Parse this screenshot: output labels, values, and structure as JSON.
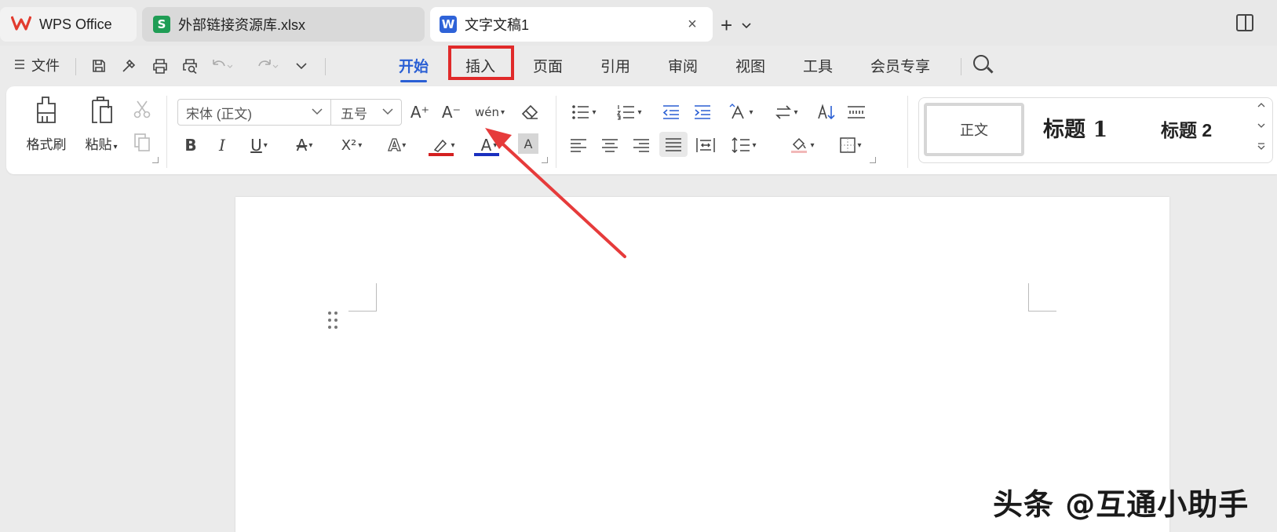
{
  "tabs": {
    "home": {
      "label": "WPS Office",
      "badge": "W",
      "color": "#e23b2e"
    },
    "xlsx": {
      "label": "外部链接资源库.xlsx",
      "badge": "S",
      "color": "#1f9d55"
    },
    "doc": {
      "label": "文字文稿1",
      "badge": "W",
      "color": "#2f63d8"
    },
    "close": "×",
    "new_tab": "+",
    "new_tab_menu": "⌄"
  },
  "menubar": {
    "file_label": "文件",
    "tabs": [
      "开始",
      "插入",
      "页面",
      "引用",
      "审阅",
      "视图",
      "工具",
      "会员专享"
    ],
    "active_tab": "开始",
    "highlighted_tab": "插入"
  },
  "ribbon": {
    "format_painter": "格式刷",
    "paste": "粘贴",
    "font_name": "宋体 (正文)",
    "font_size": "五号",
    "grow_font": "A⁺",
    "shrink_font": "A⁻",
    "pinyin": "wén",
    "bold": "B",
    "italic": "I",
    "underline": "U",
    "strike": "A",
    "superscript": "X²",
    "text_effect": "A",
    "font_color_letter": "A",
    "char_shading": "A",
    "highlight_color": "#d42020",
    "font_color": "#1a2fbf",
    "styles": {
      "normal": "正文",
      "heading1": "标题 1",
      "heading2": "标题 2"
    }
  },
  "watermark": "头条 @互通小助手",
  "colors": {
    "accent": "#2a5fd4",
    "annotation_red": "#e02a2a"
  }
}
